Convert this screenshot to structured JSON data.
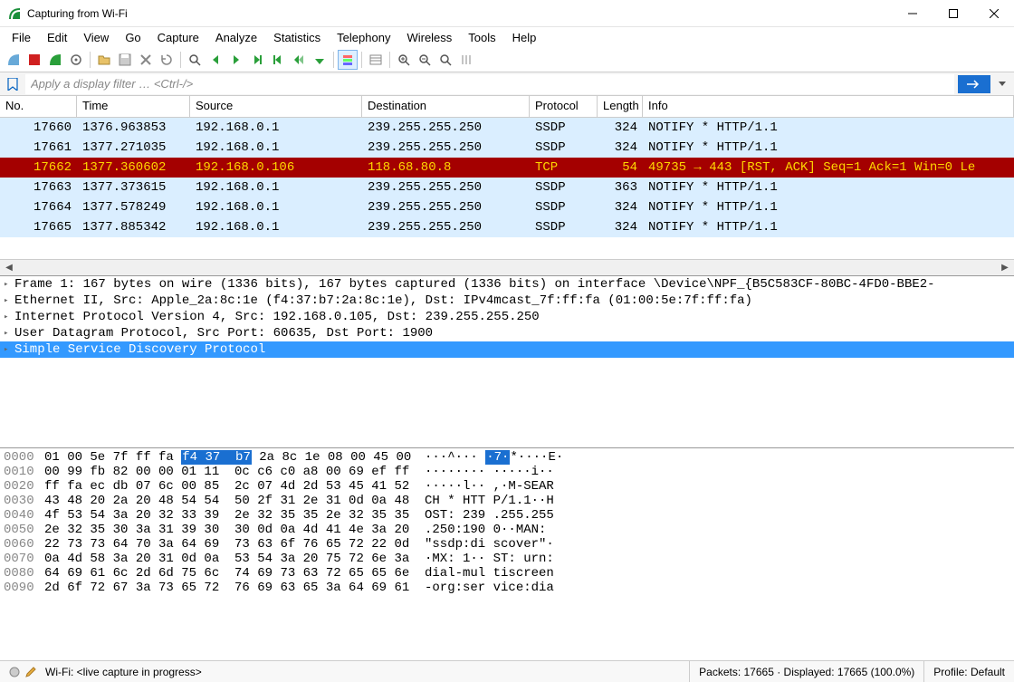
{
  "window": {
    "title": "Capturing from Wi-Fi"
  },
  "menu": [
    "File",
    "Edit",
    "View",
    "Go",
    "Capture",
    "Analyze",
    "Statistics",
    "Telephony",
    "Wireless",
    "Tools",
    "Help"
  ],
  "filter": {
    "placeholder": "Apply a display filter … <Ctrl-/>"
  },
  "columns": {
    "no": "No.",
    "time": "Time",
    "source": "Source",
    "destination": "Destination",
    "protocol": "Protocol",
    "length": "Length",
    "info": "Info"
  },
  "packets": [
    {
      "no": "17660",
      "time": "1376.963853",
      "src": "192.168.0.1",
      "dst": "239.255.255.250",
      "proto": "SSDP",
      "len": "324",
      "info": "NOTIFY * HTTP/1.1",
      "cls": "ssdp"
    },
    {
      "no": "17661",
      "time": "1377.271035",
      "src": "192.168.0.1",
      "dst": "239.255.255.250",
      "proto": "SSDP",
      "len": "324",
      "info": "NOTIFY * HTTP/1.1",
      "cls": "ssdp"
    },
    {
      "no": "17662",
      "time": "1377.360602",
      "src": "192.168.0.106",
      "dst": "118.68.80.8",
      "proto": "TCP",
      "len": "54",
      "info": "49735 → 443 [RST, ACK] Seq=1 Ack=1 Win=0 Le",
      "cls": "tcp-rst"
    },
    {
      "no": "17663",
      "time": "1377.373615",
      "src": "192.168.0.1",
      "dst": "239.255.255.250",
      "proto": "SSDP",
      "len": "363",
      "info": "NOTIFY * HTTP/1.1",
      "cls": "ssdp"
    },
    {
      "no": "17664",
      "time": "1377.578249",
      "src": "192.168.0.1",
      "dst": "239.255.255.250",
      "proto": "SSDP",
      "len": "324",
      "info": "NOTIFY * HTTP/1.1",
      "cls": "ssdp"
    },
    {
      "no": "17665",
      "time": "1377.885342",
      "src": "192.168.0.1",
      "dst": "239.255.255.250",
      "proto": "SSDP",
      "len": "324",
      "info": "NOTIFY * HTTP/1.1",
      "cls": "ssdp"
    }
  ],
  "details": [
    {
      "text": "Frame 1: 167 bytes on wire (1336 bits), 167 bytes captured (1336 bits) on interface \\Device\\NPF_{B5C583CF-80BC-4FD0-BBE2-",
      "sel": false
    },
    {
      "text": "Ethernet II, Src: Apple_2a:8c:1e (f4:37:b7:2a:8c:1e), Dst: IPv4mcast_7f:ff:fa (01:00:5e:7f:ff:fa)",
      "sel": false
    },
    {
      "text": "Internet Protocol Version 4, Src: 192.168.0.105, Dst: 239.255.255.250",
      "sel": false
    },
    {
      "text": "User Datagram Protocol, Src Port: 60635, Dst Port: 1900",
      "sel": false
    },
    {
      "text": "Simple Service Discovery Protocol",
      "sel": true
    }
  ],
  "hex": [
    {
      "off": "0000",
      "b1": "01 00 5e 7f ff fa ",
      "hl": "f4 37  b7",
      "b2": " 2a 8c 1e 08 00 45 00",
      "a1": "···^··· ",
      "ahl": "·7·",
      "a2": "*····E·"
    },
    {
      "off": "0010",
      "b1": "00 99 fb 82 00 00 01 11  0c c6 c0 a8 00 69 ef ff",
      "a1": "········ ·····i··"
    },
    {
      "off": "0020",
      "b1": "ff fa ec db 07 6c 00 85  2c 07 4d 2d 53 45 41 52",
      "a1": "·····l·· ,·M-SEAR"
    },
    {
      "off": "0030",
      "b1": "43 48 20 2a 20 48 54 54  50 2f 31 2e 31 0d 0a 48",
      "a1": "CH * HTT P/1.1··H"
    },
    {
      "off": "0040",
      "b1": "4f 53 54 3a 20 32 33 39  2e 32 35 35 2e 32 35 35",
      "a1": "OST: 239 .255.255"
    },
    {
      "off": "0050",
      "b1": "2e 32 35 30 3a 31 39 30  30 0d 0a 4d 41 4e 3a 20",
      "a1": ".250:190 0··MAN: "
    },
    {
      "off": "0060",
      "b1": "22 73 73 64 70 3a 64 69  73 63 6f 76 65 72 22 0d",
      "a1": "\"ssdp:di scover\"·"
    },
    {
      "off": "0070",
      "b1": "0a 4d 58 3a 20 31 0d 0a  53 54 3a 20 75 72 6e 3a",
      "a1": "·MX: 1·· ST: urn:"
    },
    {
      "off": "0080",
      "b1": "64 69 61 6c 2d 6d 75 6c  74 69 73 63 72 65 65 6e",
      "a1": "dial-mul tiscreen"
    },
    {
      "off": "0090",
      "b1": "2d 6f 72 67 3a 73 65 72  76 69 63 65 3a 64 69 61",
      "a1": "-org:ser vice:dia"
    }
  ],
  "status": {
    "left_icon_label": "",
    "interface": "Wi-Fi: <live capture in progress>",
    "packets": "Packets: 17665 · Displayed: 17665 (100.0%)",
    "profile": "Profile: Default"
  }
}
